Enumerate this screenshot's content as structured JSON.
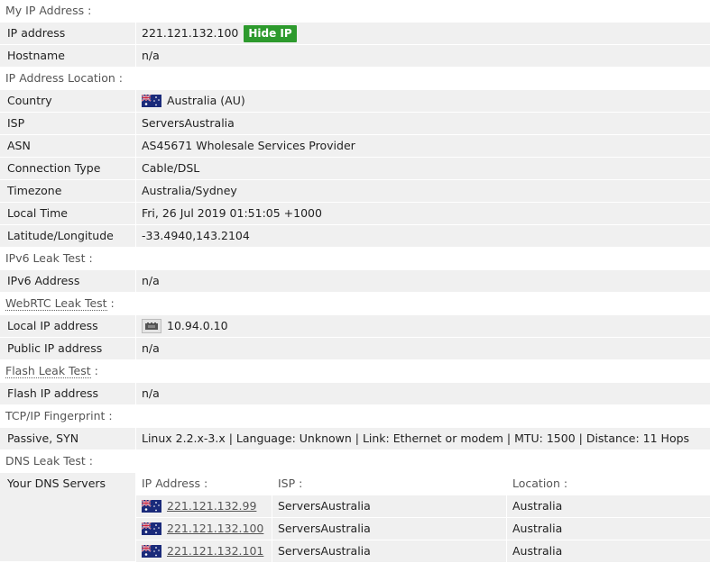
{
  "sections": {
    "my_ip": "My IP Address :",
    "location": "IP Address Location :",
    "ipv6": "IPv6 Leak Test :",
    "webrtc": "WebRTC Leak Test",
    "webrtc_colon": " :",
    "flash": "Flash Leak Test",
    "flash_colon": " :",
    "tcpip": "TCP/IP Fingerprint :",
    "dns": "DNS Leak Test :"
  },
  "my_ip": {
    "ip_label": "IP address",
    "ip_value": "221.121.132.100",
    "hide_ip_button": "Hide IP",
    "hostname_label": "Hostname",
    "hostname_value": "n/a"
  },
  "location": {
    "country_label": "Country",
    "country_value": "Australia (AU)",
    "isp_label": "ISP",
    "isp_value": "ServersAustralia",
    "asn_label": "ASN",
    "asn_value": "AS45671 Wholesale Services Provider",
    "conn_label": "Connection Type",
    "conn_value": "Cable/DSL",
    "tz_label": "Timezone",
    "tz_value": "Australia/Sydney",
    "time_label": "Local Time",
    "time_value": "Fri, 26 Jul 2019 01:51:05 +1000",
    "latlon_label": "Latitude/Longitude",
    "latlon_value": "-33.4940,143.2104"
  },
  "ipv6": {
    "label": "IPv6 Address",
    "value": "n/a"
  },
  "webrtc": {
    "local_label": "Local IP address",
    "local_value": "10.94.0.10",
    "public_label": "Public IP address",
    "public_value": "n/a"
  },
  "flash": {
    "label": "Flash IP address",
    "value": "n/a"
  },
  "tcpip": {
    "label": "Passive, SYN",
    "value": "Linux 2.2.x-3.x | Language: Unknown | Link: Ethernet or modem | MTU: 1500 | Distance: 11 Hops"
  },
  "dns": {
    "label": "Your DNS Servers",
    "headers": {
      "ip": "IP Address :",
      "isp": "ISP :",
      "location": "Location :"
    },
    "rows": [
      {
        "ip": "221.121.132.99",
        "isp": "ServersAustralia",
        "location": "Australia"
      },
      {
        "ip": "221.121.132.100",
        "isp": "ServersAustralia",
        "location": "Australia"
      },
      {
        "ip": "221.121.132.101",
        "isp": "ServersAustralia",
        "location": "Australia"
      }
    ]
  },
  "icons": {
    "flag": "australia-flag-icon",
    "network": "network-card-icon"
  },
  "colors": {
    "hide_button": "#2d9a2d",
    "row_bg": "#f0f0f0",
    "section_text": "#555555"
  }
}
